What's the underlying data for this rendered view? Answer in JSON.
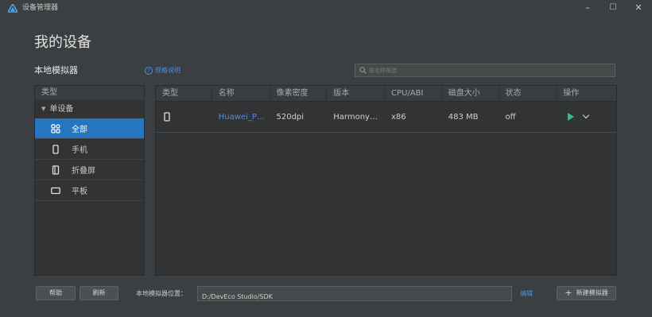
{
  "window": {
    "title": "设备管理器",
    "minimize": "–",
    "maximize": "☐",
    "close": "✕"
  },
  "page": {
    "title": "我的设备",
    "section_title": "本地模拟器",
    "help_link": "规格说明",
    "search_placeholder": "按名称筛选"
  },
  "category_panel": {
    "header": "类型",
    "group_label": "单设备",
    "items": [
      {
        "label": "全部",
        "icon": "grid-icon",
        "selected": true
      },
      {
        "label": "手机",
        "icon": "phone-icon",
        "selected": false
      },
      {
        "label": "折叠屏",
        "icon": "foldable-icon",
        "selected": false
      },
      {
        "label": "平板",
        "icon": "tablet-icon",
        "selected": false
      }
    ]
  },
  "table": {
    "columns": [
      "类型",
      "名称",
      "像素密度",
      "版本",
      "CPU/ABI",
      "磁盘大小",
      "状态",
      "操作"
    ],
    "rows": [
      {
        "type_icon": "phone-icon",
        "name": "Huawei_P…",
        "density": "520dpi",
        "version": "Harmony…",
        "cpu": "x86",
        "disk": "483 MB",
        "status": "off",
        "actions": [
          "play-icon",
          "chevron-down-icon"
        ]
      }
    ]
  },
  "footer": {
    "help_button": "帮助",
    "refresh_button": "刷新",
    "path_label": "本地模拟器位置：",
    "path_value": "D:/DevEco Studio/SDK",
    "edit_link": "编辑",
    "new_button": "新建模拟器"
  },
  "colors": {
    "background": "#3c3f41",
    "accent": "#2675bf",
    "link": "#4d8fe6",
    "play": "#3fb98a"
  }
}
